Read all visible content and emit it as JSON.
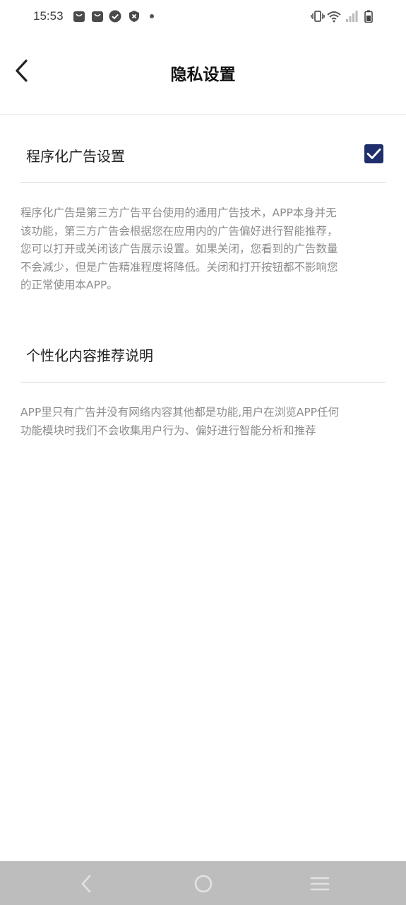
{
  "status_bar": {
    "time": "15:53",
    "left_icons": [
      "bag-icon",
      "bag-icon",
      "check-circle-icon",
      "shield-x-icon",
      "dot-icon"
    ],
    "right_icons": [
      "vibrate-icon",
      "wifi-icon",
      "signal-icon",
      "battery-icon"
    ]
  },
  "header": {
    "title": "隐私设置",
    "back_icon": "chevron-left-icon"
  },
  "programmatic_ads": {
    "label": "程序化广告设置",
    "checked": true,
    "description_lines": [
      "程序化广告是第三方广告平台使用的通用广告技术，APP本身并无",
      "该功能，第三方广告会根据您在应用内的广告偏好进行智能推荐，",
      "您可以打开或关闭该广告展示设置。如果关闭，您看到的广告数量",
      "不会减少，但是广告精准程度将降低。关闭和打开按钮都不影响您",
      "的正常使用本APP。"
    ]
  },
  "personalized": {
    "label": "个性化内容推荐说明",
    "description_lines": [
      "APP里只有广告并没有网络内容其他都是功能,用户在浏览APP任何",
      "功能模块时我们不会收集用户行为、偏好进行智能分析和推荐"
    ]
  },
  "nav_bar": {
    "buttons": [
      "back-icon",
      "home-icon",
      "menu-icon"
    ],
    "background": "#bdbdbd"
  },
  "colors": {
    "checkbox": "#1f2f6b",
    "description_text": "#8c8c8c"
  }
}
